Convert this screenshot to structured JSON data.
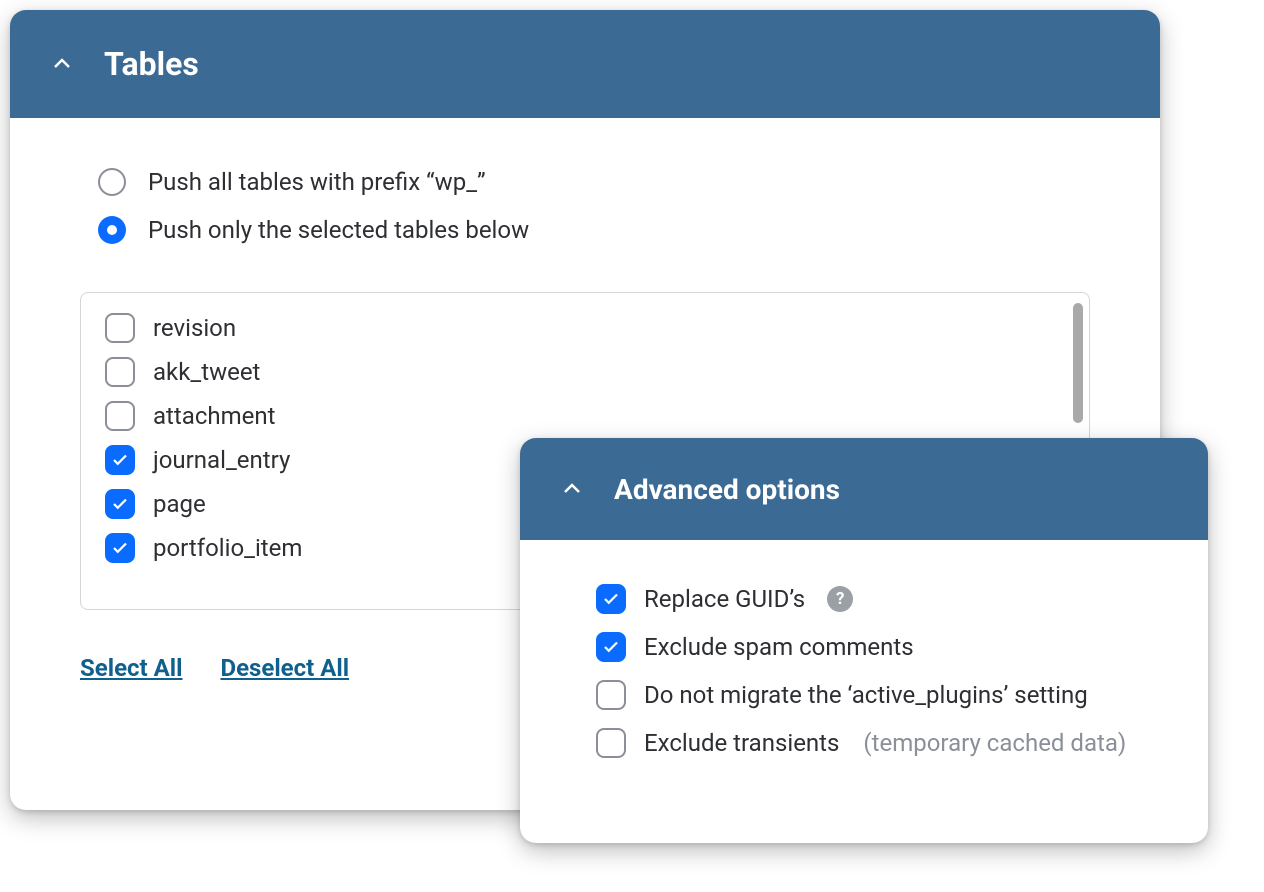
{
  "tables_panel": {
    "title": "Tables",
    "radios": {
      "push_all": "Push all tables with prefix “wp_”",
      "push_selected": "Push only the selected tables below"
    },
    "table_items": [
      {
        "label": "revision",
        "checked": false
      },
      {
        "label": "akk_tweet",
        "checked": false
      },
      {
        "label": "attachment",
        "checked": false
      },
      {
        "label": "journal_entry",
        "checked": true
      },
      {
        "label": "page",
        "checked": true
      },
      {
        "label": "portfolio_item",
        "checked": true
      }
    ],
    "actions": {
      "select_all": "Select All",
      "deselect_all": "Deselect All"
    }
  },
  "advanced_panel": {
    "title": "Advanced options",
    "options": {
      "replace_guids": {
        "label": "Replace GUID’s",
        "checked": true,
        "has_help": true
      },
      "exclude_spam": {
        "label": "Exclude spam comments",
        "checked": true
      },
      "no_active_plugins": {
        "label": "Do not migrate the ‘active_plugins’ setting",
        "checked": false
      },
      "exclude_transients": {
        "label": "Exclude transients",
        "checked": false,
        "hint": "(temporary cached data)"
      }
    }
  }
}
